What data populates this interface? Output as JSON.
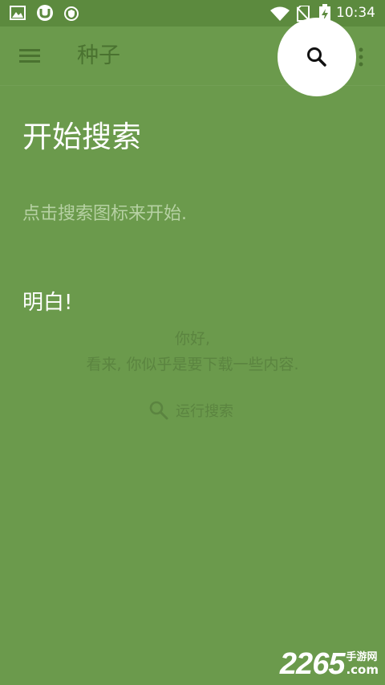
{
  "status_bar": {
    "time": "10:34",
    "icons": [
      "image-notification-icon",
      "utorrent-notification-icon",
      "shield-notification-icon",
      "wifi-icon",
      "no-sim-icon",
      "battery-charging-icon"
    ]
  },
  "toolbar": {
    "title": "种子",
    "menu_icon": "hamburger-menu-icon",
    "search_icon": "search-icon",
    "overflow_icon": "more-vert-icon"
  },
  "tip": {
    "title": "开始搜索",
    "body": "点击搜索图标来开始.",
    "dismiss": "明白!"
  },
  "empty_state": {
    "greeting": "你好,",
    "message": "看来, 你似乎是要下载一些内容.",
    "run_search_label": "运行搜索",
    "run_search_icon": "search-icon"
  },
  "watermark": {
    "number": "2265",
    "site": "手游网",
    "tld": ".com"
  },
  "colors": {
    "background": "#6b9a4c",
    "status_bar": "#5c8a3e",
    "highlight": "#ffffff"
  }
}
